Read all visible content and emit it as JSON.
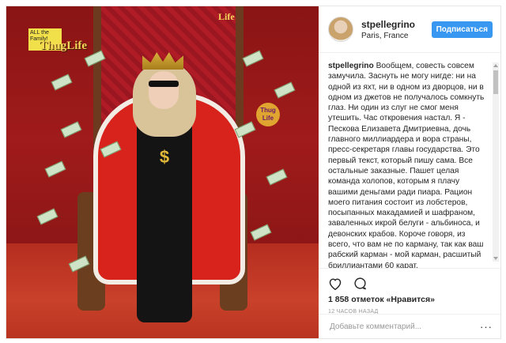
{
  "photo": {
    "sign_text": "ALL the Family!",
    "logo_text": "ThugLife",
    "logo_corner_text": "Life",
    "badge_text": "Thug Life",
    "pendant_text": "$"
  },
  "header": {
    "username": "stpellegrino",
    "location": "Paris, France",
    "follow_label": "Подписаться"
  },
  "caption": {
    "username": "stpellegrino",
    "text": "Вообщем, совесть совсем замучила. Заснуть не могу нигде: ни на одной из яхт, ни в одном из дворцов, ни в одном из джетов не получалось сомкнуть глаз. Ни один из слуг не смог меня утешить. Час откровения настал. Я - Пескова Елизавета Дмитриевна, дочь главного миллиардера и вора страны, пресс-секретаря главы государства. Это первый текст, который пишу сама. Все остальные заказные. Пашет целая команда холопов, которым я плачу вашими деньгами ради пиара. Рацион моего питания состоит из лобстеров, посыпанных макадамией и шафраном, заваленных икрой белуги - альбиноса, и девонских крабов. Короче говоря, из всего, что вам не по карману, так как ваш рабский карман - мой карман, расшитый бриллиантами 60 карат."
  },
  "actions": {
    "like_icon": "heart-icon",
    "comment_icon": "comment-bubble-icon"
  },
  "likes_text": "1 858 отметок «Нравится»",
  "timestamp": "12 ЧАСОВ НАЗАД",
  "comment": {
    "placeholder": "Добавьте комментарий...",
    "more_label": "···"
  },
  "colors": {
    "follow_button": "#3897f0",
    "text": "#262626",
    "muted": "#999999",
    "border": "#efefef"
  }
}
